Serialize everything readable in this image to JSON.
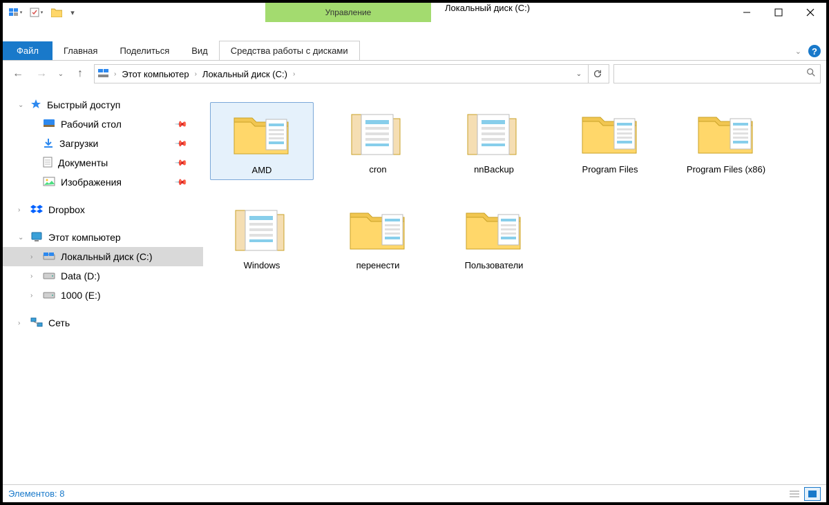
{
  "window": {
    "title": "Локальный диск (C:)",
    "context_tab_header": "Управление"
  },
  "tabs": {
    "file": "Файл",
    "home": "Главная",
    "share": "Поделиться",
    "view": "Вид",
    "drive_tools": "Средства работы с дисками"
  },
  "breadcrumb": {
    "item0": "Этот компьютер",
    "item1": "Локальный диск (C:)"
  },
  "sidebar": {
    "quick_access": "Быстрый доступ",
    "desktop": "Рабочий стол",
    "downloads": "Загрузки",
    "documents": "Документы",
    "pictures": "Изображения",
    "dropbox": "Dropbox",
    "this_pc": "Этот компьютер",
    "local_disk_c": "Локальный диск (C:)",
    "data_d": "Data (D:)",
    "data_e": "1000 (E:)",
    "network": "Сеть"
  },
  "folders": [
    {
      "name": "AMD",
      "selected": true,
      "open": false
    },
    {
      "name": "cron",
      "selected": false,
      "open": true
    },
    {
      "name": "nnBackup",
      "selected": false,
      "open": true
    },
    {
      "name": "Program Files",
      "selected": false,
      "open": false
    },
    {
      "name": "Program Files (x86)",
      "selected": false,
      "open": false
    },
    {
      "name": "Windows",
      "selected": false,
      "open": true
    },
    {
      "name": "перенести",
      "selected": false,
      "open": false
    },
    {
      "name": "Пользователи",
      "selected": false,
      "open": false
    }
  ],
  "statusbar": {
    "items_label": "Элементов:",
    "items_count": "8"
  }
}
